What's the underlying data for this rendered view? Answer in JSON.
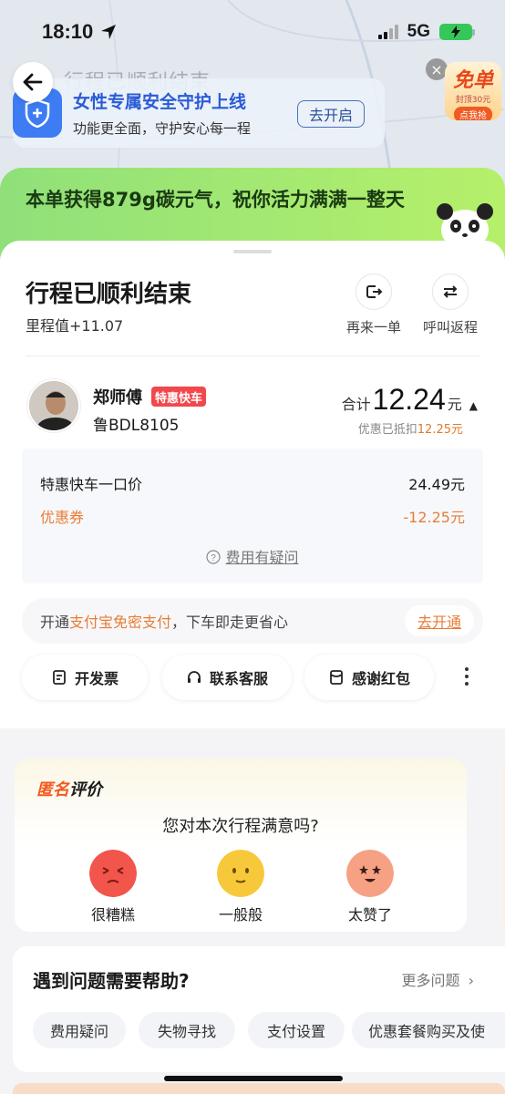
{
  "status_bar": {
    "time": "18:10",
    "network": "5G"
  },
  "header": {
    "background_title": "行程已顺利结束"
  },
  "safety_banner": {
    "title": "女性专属安全守护上线",
    "subtitle": "功能更全面，守护安心每一程",
    "button": "去开启"
  },
  "promo": {
    "title": "免单",
    "subtitle": "封顶30元",
    "button": "点我抢"
  },
  "carbon": {
    "text": "本单获得879g碳元气，祝你活力满满一整天"
  },
  "trip": {
    "title": "行程已顺利结束",
    "mileage": "里程值+11.07",
    "actions": [
      {
        "label": "再来一单",
        "icon": "redo-icon"
      },
      {
        "label": "呼叫返程",
        "icon": "return-trip-icon"
      }
    ]
  },
  "driver": {
    "name": "郑师傅",
    "tag": "特惠快车",
    "plate": "鲁BDL8105"
  },
  "fare": {
    "total_label": "合计",
    "total_value": "12.24",
    "total_unit": "元",
    "discount_prefix": "优惠已抵扣",
    "discount_amount": "12.25元",
    "rows": [
      {
        "label": "特惠快车一口价",
        "value": "24.49元"
      },
      {
        "label": "优惠券",
        "value": "-12.25元"
      }
    ],
    "question": "费用有疑问"
  },
  "payment": {
    "prefix": "开通",
    "highlight": "支付宝免密支付",
    "suffix": "，下车即走更省心",
    "button": "去开通"
  },
  "quick_actions": [
    {
      "label": "开发票",
      "icon": "invoice-icon"
    },
    {
      "label": "联系客服",
      "icon": "headset-icon"
    },
    {
      "label": "感谢红包",
      "icon": "red-envelope-icon"
    }
  ],
  "review": {
    "title_a": "匿名",
    "title_b": "评价",
    "question": "您对本次行程满意吗?",
    "options": [
      {
        "label": "很糟糕",
        "color": "#f2554b"
      },
      {
        "label": "一般般",
        "color": "#f7c93a"
      },
      {
        "label": "太赞了",
        "color": "#f6a184"
      }
    ]
  },
  "help": {
    "title": "遇到问题需要帮助?",
    "more": "更多问题",
    "chips": [
      "费用疑问",
      "失物寻找",
      "支付设置",
      "优惠套餐购买及使"
    ]
  },
  "colors": {
    "accent_orange": "#e87d38",
    "tag_red": "#f2474b",
    "blue": "#3d7cf3",
    "green": "#8fe07a"
  }
}
